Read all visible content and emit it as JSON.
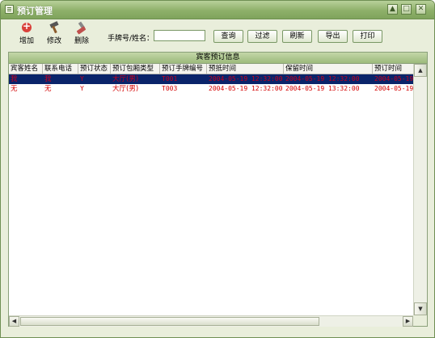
{
  "window": {
    "title": "预订管理"
  },
  "toolbar": {
    "add_label": "增加",
    "edit_label": "修改",
    "delete_label": "删除",
    "search_label": "手牌号/姓名：",
    "search_value": "",
    "buttons": [
      "查询",
      "过滤",
      "刷新",
      "导出",
      "打印"
    ]
  },
  "grid": {
    "title": "宾客预订信息",
    "columns": [
      "宾客姓名",
      "联系电话",
      "预订状态",
      "预订包厢类型",
      "预订手牌编号",
      "预抵时间",
      "保留时间",
      "预订时间"
    ],
    "rows": [
      {
        "cells": [
          "我",
          "我",
          "Y",
          "大厅(男)",
          "T001",
          "2004-05-19 12:32:00",
          "2004-05-19 12:32:00",
          "2004-05-19"
        ],
        "selected": true
      },
      {
        "cells": [
          "无",
          "无",
          "Y",
          "大厅(男)",
          "T003",
          "2004-05-19 12:32:00",
          "2004-05-19 13:32:00",
          "2004-05-19"
        ],
        "selected": false
      }
    ]
  },
  "colors": {
    "title_bar": "#8eb06a",
    "selection": "#0a246a",
    "row_text": "#d40000",
    "window_bg": "#e9eedb"
  }
}
